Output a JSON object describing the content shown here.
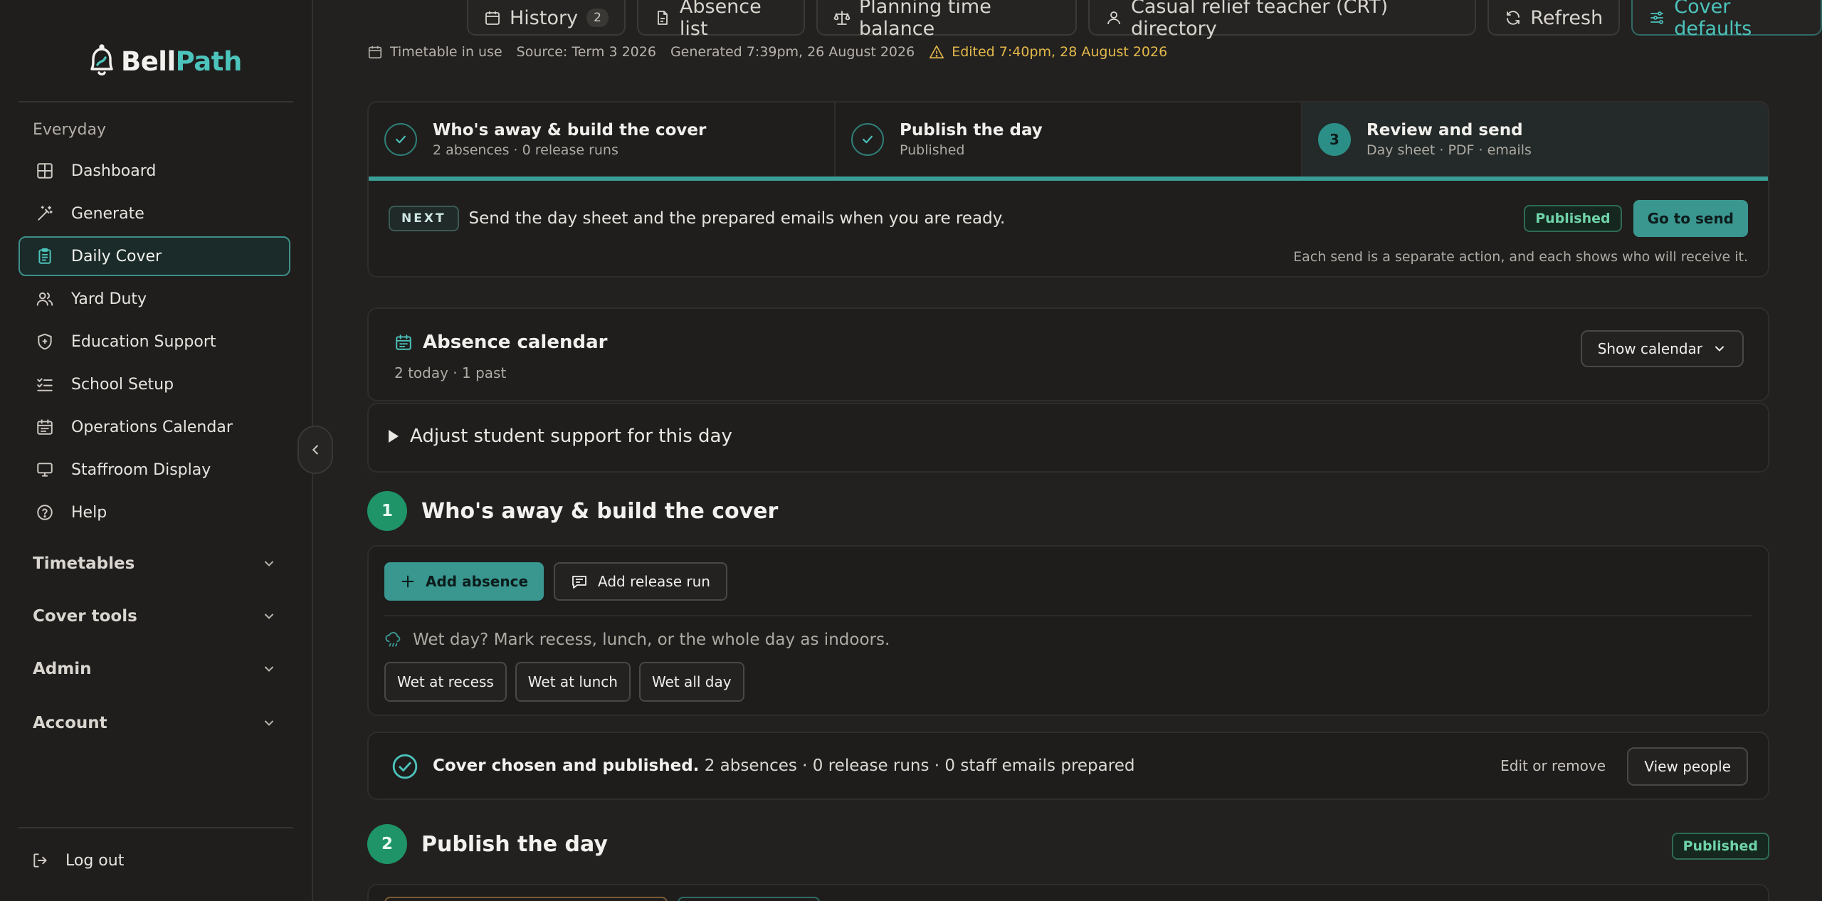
{
  "brand": {
    "name_part1": "Bell",
    "name_part2": "Path"
  },
  "sidebar": {
    "section_label": "Everyday",
    "items": [
      {
        "label": "Dashboard",
        "icon": "grid-icon"
      },
      {
        "label": "Generate",
        "icon": "wand-icon"
      },
      {
        "label": "Daily Cover",
        "icon": "clipboard-icon",
        "active": true
      },
      {
        "label": "Yard Duty",
        "icon": "users-icon"
      },
      {
        "label": "Education Support",
        "icon": "shield-icon"
      },
      {
        "label": "School Setup",
        "icon": "checklist-icon"
      },
      {
        "label": "Operations Calendar",
        "icon": "calendar-icon"
      },
      {
        "label": "Staffroom Display",
        "icon": "monitor-icon"
      },
      {
        "label": "Help",
        "icon": "help-icon"
      }
    ],
    "groups": [
      "Timetables",
      "Cover tools",
      "Admin",
      "Account"
    ],
    "logout_label": "Log out"
  },
  "topbar": {
    "history_label": "History",
    "history_count": "2",
    "absence_list_label": "Absence list",
    "planning_label": "Planning time balance",
    "crt_label": "Casual relief teacher (CRT) directory",
    "refresh_label": "Refresh",
    "cover_defaults_label": "Cover defaults"
  },
  "meta": {
    "timetable": "Timetable in use",
    "source": "Source: Term 3 2026",
    "generated": "Generated 7:39pm, 26 August 2026",
    "edited": "Edited 7:40pm, 28 August 2026"
  },
  "stepper": {
    "steps": [
      {
        "title": "Who's away & build the cover",
        "sub": "2 absences · 0 release runs",
        "state": "done"
      },
      {
        "title": "Publish the day",
        "sub": "Published",
        "state": "done"
      },
      {
        "title": "Review and send",
        "sub": "Day sheet · PDF · emails",
        "state": "current",
        "number": "3"
      }
    ],
    "next_tag": "NEXT",
    "next_text": "Send the day sheet and the prepared emails when you are ready.",
    "status": "Published",
    "go_label": "Go to send",
    "note": "Each send is a separate action, and each shows who will receive it."
  },
  "calendar": {
    "title": "Absence calendar",
    "sub": "2 today · 1 past",
    "show_label": "Show calendar"
  },
  "support": {
    "label": "Adjust student support for this day"
  },
  "section1": {
    "number": "1",
    "title": "Who's away & build the cover",
    "add_absence": "Add absence",
    "add_release": "Add release run",
    "wet_note": "Wet day? Mark recess, lunch, or the whole day as indoors.",
    "wet_buttons": [
      "Wet at recess",
      "Wet at lunch",
      "Wet all day"
    ]
  },
  "chosen": {
    "bold": "Cover chosen and published.",
    "rest": " 2 absences · 0 release runs · 0 staff emails prepared",
    "edit_label": "Edit or remove",
    "view_label": "View people"
  },
  "section2": {
    "number": "2",
    "title": "Publish the day",
    "status": "Published"
  },
  "colors": {
    "accent": "#4cc3bb",
    "success": "#1f9468",
    "warning": "#e4b94a"
  }
}
